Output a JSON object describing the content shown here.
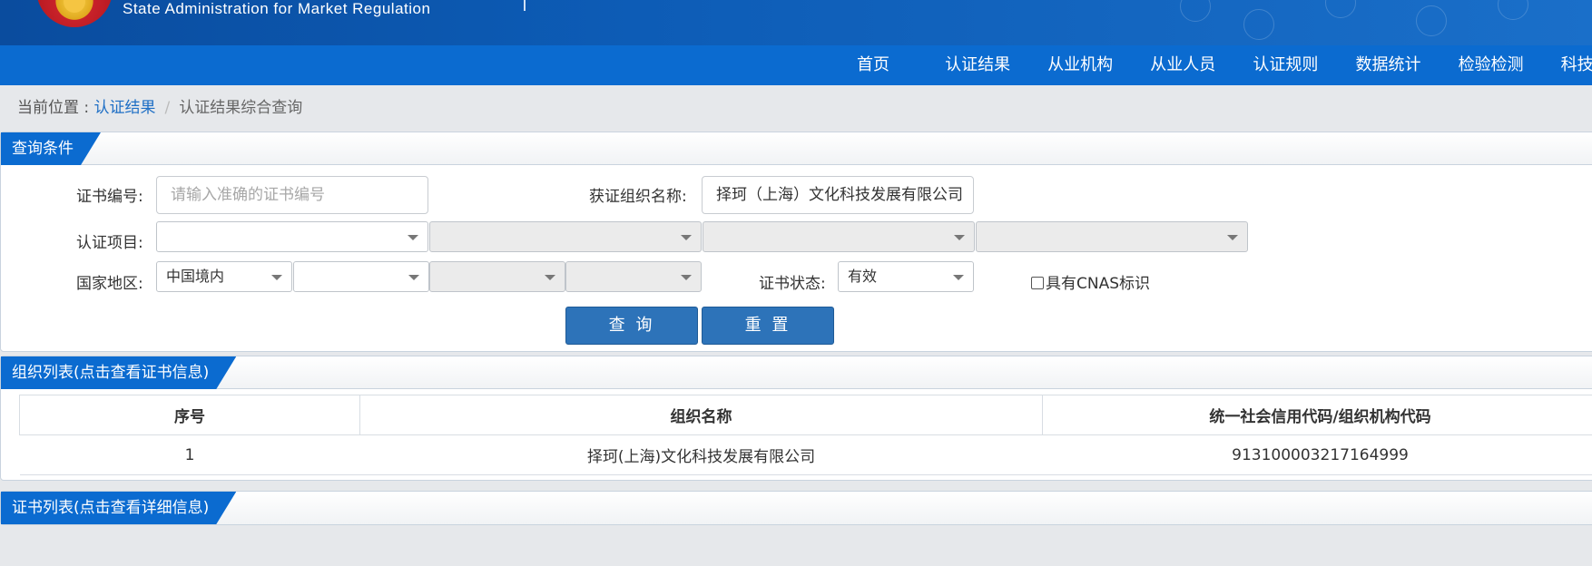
{
  "header": {
    "en_name": "State Administration  for  Market Regulation"
  },
  "nav": {
    "items": [
      "首页",
      "认证结果",
      "从业机构",
      "从业人员",
      "认证规则",
      "数据统计",
      "检验检测",
      "科技"
    ]
  },
  "breadcrumb": {
    "prefix": "当前位置 : ",
    "link": "认证结果",
    "separator": "/",
    "current": "认证结果综合查询"
  },
  "query_panel": {
    "title": "查询条件",
    "cert_no_label": "证书编号:",
    "cert_no_placeholder": "请输入准确的证书编号",
    "org_name_label": "获证组织名称:",
    "org_name_value": "择珂（上海）文化科技发展有限公司",
    "project_label": "认证项目:",
    "region_label": "国家地区:",
    "region_value": "中国境内",
    "status_label": "证书状态:",
    "status_value": "有效",
    "cnas_label": "具有CNAS标识",
    "search_button": "查 询",
    "reset_button": "重 置"
  },
  "org_panel": {
    "title": "组织列表(点击查看证书信息)",
    "columns": [
      "序号",
      "组织名称",
      "统一社会信用代码/组织机构代码"
    ],
    "rows": [
      [
        "1",
        "择珂(上海)文化科技发展有限公司",
        "913100003217164999"
      ]
    ]
  },
  "cert_panel": {
    "title": "证书列表(点击查看详细信息)"
  },
  "colors": {
    "primary_blue": "#0b6bd0",
    "button_blue": "#2d73b9",
    "link_blue": "#1f6fc5"
  }
}
